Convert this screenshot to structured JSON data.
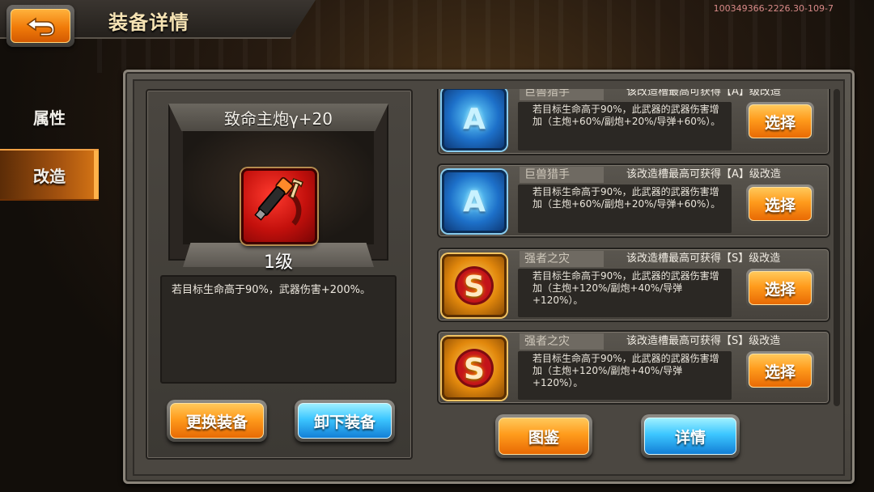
{
  "header": {
    "title": "装备详情",
    "version": "100349366-2226.30-109-7"
  },
  "tabs": [
    {
      "label": "属性",
      "active": false
    },
    {
      "label": "改造",
      "active": true
    }
  ],
  "item": {
    "name": "致命主炮γ+20",
    "level": "1级",
    "description": "若目标生命高于90%，武器伤害+200%。",
    "icon": "cannon-wrench-icon"
  },
  "buttons": {
    "replace": "更换装备",
    "unequip": "卸下装备",
    "codex": "图鉴",
    "detail": "详情"
  },
  "slots": [
    {
      "name": "巨兽猎手",
      "grade": "A",
      "cap": "该改造槽最高可获得【A】级改造",
      "description": "若目标生命高于90%，此武器的武器伤害增加（主炮+60%/副炮+20%/导弹+60%）。",
      "button": "选择"
    },
    {
      "name": "巨兽猎手",
      "grade": "A",
      "cap": "该改造槽最高可获得【A】级改造",
      "description": "若目标生命高于90%，此武器的武器伤害增加（主炮+60%/副炮+20%/导弹+60%）。",
      "button": "选择"
    },
    {
      "name": "强者之灾",
      "grade": "S",
      "cap": "该改造槽最高可获得【S】级改造",
      "description": "若目标生命高于90%，此武器的武器伤害增加（主炮+120%/副炮+40%/导弹+120%）。",
      "button": "选择"
    },
    {
      "name": "强者之灾",
      "grade": "S",
      "cap": "该改造槽最高可获得【S】级改造",
      "description": "若目标生命高于90%，此武器的武器伤害增加（主炮+120%/副炮+40%/导弹+120%）。",
      "button": "选择"
    }
  ],
  "colors": {
    "accent_orange": "#f07a09",
    "accent_blue": "#3cc6ff",
    "title_gold": "#f6e3b4",
    "panel": "#48443e"
  }
}
